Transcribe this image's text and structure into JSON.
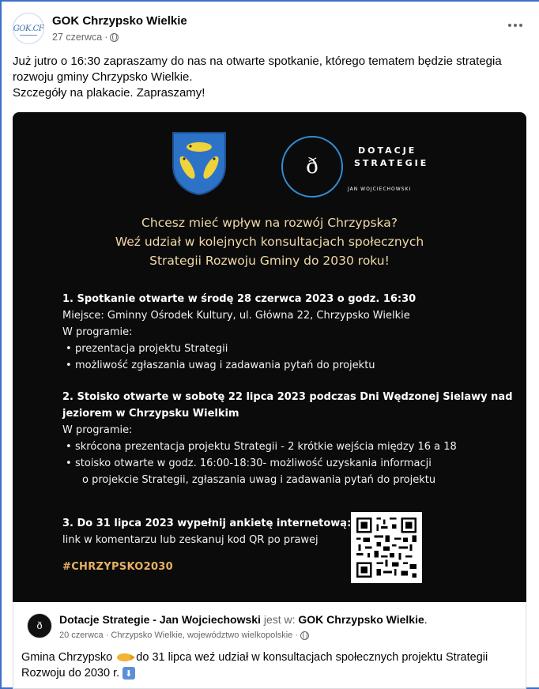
{
  "post": {
    "page_name": "GOK Chrzypsko Wielkie",
    "avatar_text": "GOK.CF",
    "date": "27 czerwca",
    "separator": "·",
    "text_line1": "Już jutro o 16:30 zapraszamy do nas na otwarte spotkanie, którego tematem będzie strategia",
    "text_line2": "rozwoju gminy Chrzypsko Wielkie.",
    "text_line3": "Szczegóły na plakacie. Zapraszamy!"
  },
  "poster": {
    "logo_glyph": "ð",
    "brand_line1": "DOTACJE",
    "brand_line2": "STRATEGIE",
    "brand_line3": "JAN WOJCIECHOWSKI",
    "headline": [
      "Chcesz mieć wpływ na rozwój Chrzypska?",
      "Weź udział w kolejnych konsultacjach społecznych",
      "Strategii Rozwoju Gminy do 2030 roku!"
    ],
    "section1": {
      "heading": "1. Spotkanie otwarte w środę 28 czerwca 2023 o godz. 16:30",
      "place": "Miejsce: Gminny Ośrodek Kultury, ul. Główna 22, Chrzypsko Wielkie",
      "program_label": "W programie:",
      "bullets": [
        "prezentacja projektu Strategii",
        "możliwość zgłaszania uwag i zadawania pytań do projektu"
      ]
    },
    "section2": {
      "heading_line1": "2. Stoisko otwarte w sobotę 22 lipca 2023 podczas Dni Wędzonej Sielawy nad",
      "heading_line2": "jeziorem w Chrzypsku Wielkim",
      "program_label": "W programie:",
      "bullets": [
        "skrócona prezentacja projektu Strategii - 2 krótkie wejścia między 16 a 18",
        "stoisko otwarte w godz. 16:00-18:30- możliwość uzyskania informacji",
        "o projekcie Strategii, zgłaszania uwag i zadawania pytań do projektu"
      ]
    },
    "section3": {
      "heading": "3. Do 31 lipca 2023 wypełnij ankietę internetową:",
      "line2": "link w komentarzu lub zeskanuj kod QR po prawej"
    },
    "hashtag": "#CHRZYPSKO2030"
  },
  "shared": {
    "author": "Dotacje Strategie - Jan Wojciechowski",
    "is_in": " jest w: ",
    "place_page": "GOK Chrzypsko Wielkie",
    "period": ".",
    "meta": "20 czerwca · Chrzypsko Wielkie, województwo wielkopolskie ·",
    "text_part1": "Gmina Chrzypsko",
    "text_part2": "do 31 lipca weź udział w konsultacjach społecznych projektu Strategii",
    "text_line2": "Rozwoju do 2030 r."
  },
  "icons": {
    "globe": "globe-icon",
    "more": "more-options-icon",
    "fish_emoji": "fish-emoji-icon",
    "down_arrow_emoji": "down-arrow-emoji-icon"
  },
  "colors": {
    "frame": "#3b6fc9",
    "poster_bg": "#0b0b0b",
    "headline": "#f1d9a8",
    "hashtag": "#e7b062",
    "logo_ring": "#2f8fd8"
  }
}
